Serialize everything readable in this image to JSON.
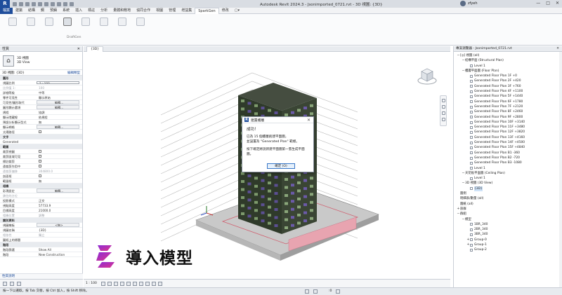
{
  "titlebar": {
    "logo": "R",
    "title": "Autodesk Revit 2024.3 - Jsonimported_0721.rvt - 3D 視圖: {3D}",
    "user": "zfyeh",
    "min": "—",
    "max": "□",
    "close": "✕"
  },
  "ribbon_tabs": [
    "檔案",
    "建築",
    "結構",
    "鋼",
    "預鑄",
    "系統",
    "插入",
    "標註",
    "分析",
    "量體和敷地",
    "協同合作",
    "視圖",
    "管理",
    "增益集",
    "SparkGen",
    "修改",
    "▢▾"
  ],
  "ribbon_tools": [
    "",
    "",
    "",
    "",
    "",
    "",
    "",
    ""
  ],
  "ribbon_panel_label": "DraftGen",
  "properties": {
    "header": "性質",
    "close": "✕",
    "type_name_1": "3D 視圖",
    "type_name_2": "3D View",
    "selector": "3D 視圖: {3D}",
    "edit_type": "編輯類型",
    "rows": [
      {
        "k": "圖形",
        "v": "",
        "group": true
      },
      {
        "k": "視圖比例",
        "v": "1 : 100",
        "style": "box"
      },
      {
        "k": "比例值 1:",
        "v": "100",
        "dim": true
      },
      {
        "k": "詳細等級",
        "v": "中等"
      },
      {
        "k": "零件可見性",
        "v": "顯示原始"
      },
      {
        "k": "可見性/圖形取代",
        "v": "編輯...",
        "style": "btn"
      },
      {
        "k": "圖形顯示選項",
        "v": "編輯...",
        "style": "btn"
      },
      {
        "k": "規程",
        "v": "協調"
      },
      {
        "k": "顯示隱藏線",
        "v": "依規程"
      },
      {
        "k": "預設分析顯示型式",
        "v": "無"
      },
      {
        "k": "顯示網格",
        "v": "編輯...",
        "style": "btn"
      },
      {
        "k": "太陽路徑",
        "v": "",
        "style": "chk"
      },
      {
        "k": "文字",
        "v": "",
        "group": true
      },
      {
        "k": "Generated",
        "v": ""
      },
      {
        "k": "範圍",
        "v": "",
        "group": true
      },
      {
        "k": "裁剪視圖",
        "v": "",
        "style": "chk"
      },
      {
        "k": "裁剪區域可見",
        "v": "",
        "style": "chk"
      },
      {
        "k": "標註裁剪",
        "v": "",
        "style": "chk"
      },
      {
        "k": "遠裁剪作用中",
        "v": "",
        "style": "chk"
      },
      {
        "k": "遠裁剪偏移",
        "v": "304800.0",
        "dim": true
      },
      {
        "k": "剖面框",
        "v": "",
        "style": "chk"
      },
      {
        "k": "範圍框",
        "v": "無"
      },
      {
        "k": "相機",
        "v": "",
        "group": true
      },
      {
        "k": "彩現設定",
        "v": "編輯...",
        "style": "btn"
      },
      {
        "k": "鎖住的方位",
        "v": "",
        "dim": true
      },
      {
        "k": "投影模式",
        "v": "正交"
      },
      {
        "k": "視點高度",
        "v": "57733.9"
      },
      {
        "k": "目標高度",
        "v": "21000.0"
      },
      {
        "k": "相機位置",
        "v": "調整",
        "dim": true
      },
      {
        "k": "識別資料",
        "v": "",
        "group": true
      },
      {
        "k": "視圖樣板",
        "v": "<無>",
        "style": "btn"
      },
      {
        "k": "視圖名稱",
        "v": "{3D}"
      },
      {
        "k": "相依性",
        "v": "獨立",
        "dim": true
      },
      {
        "k": "圖紙上的標題",
        "v": ""
      },
      {
        "k": "階段",
        "v": "",
        "group": true
      },
      {
        "k": "階段篩選",
        "v": "Show All"
      },
      {
        "k": "階段",
        "v": "New Construction"
      }
    ],
    "help": "性質說明",
    "apply": "套用"
  },
  "view": {
    "tab_label": "{3D}",
    "scale": "1 : 100",
    "close": "✕"
  },
  "dialog": {
    "title": "建置樓層",
    "close": "✕",
    "heading": "成功！",
    "line1": "已為 15 個樓層創建平面圖，",
    "line2": "並設置為 \"Generated Plan\" 範樣。",
    "line3": "按下確定將說新建平面圖第一張生成平面圖。",
    "ok": "確定 (O)"
  },
  "promo": {
    "caption": "導入模型"
  },
  "browser": {
    "header": "專案瀏覽器 - Jsonimported_0721.rvt",
    "close": "✕",
    "nodes": [
      {
        "tog": "−",
        "txt": "[◎] 視圖 (all)",
        "lvl": 0
      },
      {
        "tog": "−",
        "txt": "結構平面 (Structural Plan)",
        "lvl": 1
      },
      {
        "tog": "",
        "txt": "Level 1",
        "lvl": 2
      },
      {
        "tog": "−",
        "txt": "樓層平面圖 (Floor Plan)",
        "lvl": 1
      },
      {
        "tog": "",
        "txt": "Generated Floor Plan 1F +0",
        "lvl": 2
      },
      {
        "tog": "",
        "txt": "Generated Floor Plan 2F +420",
        "lvl": 2
      },
      {
        "tog": "",
        "txt": "Generated Floor Plan 3F +760",
        "lvl": 2
      },
      {
        "tog": "",
        "txt": "Generated Floor Plan 4F +1100",
        "lvl": 2
      },
      {
        "tog": "",
        "txt": "Generated Floor Plan 5F +1440",
        "lvl": 2
      },
      {
        "tog": "",
        "txt": "Generated Floor Plan 6F +1780",
        "lvl": 2
      },
      {
        "tog": "",
        "txt": "Generated Floor Plan 7F +2120",
        "lvl": 2
      },
      {
        "tog": "",
        "txt": "Generated Floor Plan 8F +2460",
        "lvl": 2
      },
      {
        "tog": "",
        "txt": "Generated Floor Plan 9F +2800",
        "lvl": 2
      },
      {
        "tog": "",
        "txt": "Generated Floor Plan 10F +3140",
        "lvl": 2
      },
      {
        "tog": "",
        "txt": "Generated Floor Plan 11F +3480",
        "lvl": 2
      },
      {
        "tog": "",
        "txt": "Generated Floor Plan 12F +3820",
        "lvl": 2
      },
      {
        "tog": "",
        "txt": "Generated Floor Plan 13F +4160",
        "lvl": 2
      },
      {
        "tog": "",
        "txt": "Generated Floor Plan 14F +4500",
        "lvl": 2
      },
      {
        "tog": "",
        "txt": "Generated Floor Plan 15F +4840",
        "lvl": 2
      },
      {
        "tog": "",
        "txt": "Generated Floor Plan B1 -360",
        "lvl": 2
      },
      {
        "tog": "",
        "txt": "Generated Floor Plan B2 -720",
        "lvl": 2
      },
      {
        "tog": "",
        "txt": "Generated Floor Plan B3 -1080",
        "lvl": 2
      },
      {
        "tog": "",
        "txt": "Level 1",
        "lvl": 2
      },
      {
        "tog": "−",
        "txt": "天花板平面圖 (Ceiling Plan)",
        "lvl": 1
      },
      {
        "tog": "",
        "txt": "Level 1",
        "lvl": 2
      },
      {
        "tog": "−",
        "txt": "3D 視圖 (3D View)",
        "lvl": 1
      },
      {
        "tog": "",
        "txt": "{3D}",
        "lvl": 2,
        "sel": true
      },
      {
        "tog": "",
        "txt": "圖例",
        "lvl": 0
      },
      {
        "tog": "",
        "txt": "明細表/數量 (all)",
        "lvl": 0
      },
      {
        "tog": "",
        "txt": "圖紙 (all)",
        "lvl": 0
      },
      {
        "tog": "+",
        "txt": "族群",
        "lvl": 0
      },
      {
        "tog": "−",
        "txt": "群組",
        "lvl": 0
      },
      {
        "tog": "−",
        "txt": "模型",
        "lvl": 1
      },
      {
        "tog": "",
        "txt": "1BR_340",
        "lvl": 2
      },
      {
        "tog": "",
        "txt": "2BR_340",
        "lvl": 2
      },
      {
        "tog": "",
        "txt": "3BR_340",
        "lvl": 2
      },
      {
        "tog": "+",
        "txt": "Group-0",
        "lvl": 2
      },
      {
        "tog": "+",
        "txt": "Group-1",
        "lvl": 2
      },
      {
        "tog": "",
        "txt": "Group-2",
        "lvl": 2
      }
    ]
  },
  "status": {
    "message": "按一下以選取，按 Tab 交替，按 Ctrl 加入，按 Shift 移除。",
    "count": ":0"
  },
  "colors": {
    "accent": "#1f4e9c",
    "building_green": "#2f3a2a",
    "window_purple": "#6b5aa8",
    "base_pink": "#e8a4b0",
    "base_gray": "#b0b0b0"
  },
  "icons": [
    "search-icon",
    "close-icon",
    "viewcube-icon",
    "house-icon",
    "revit-logo-icon",
    "user-avatar-icon"
  ]
}
